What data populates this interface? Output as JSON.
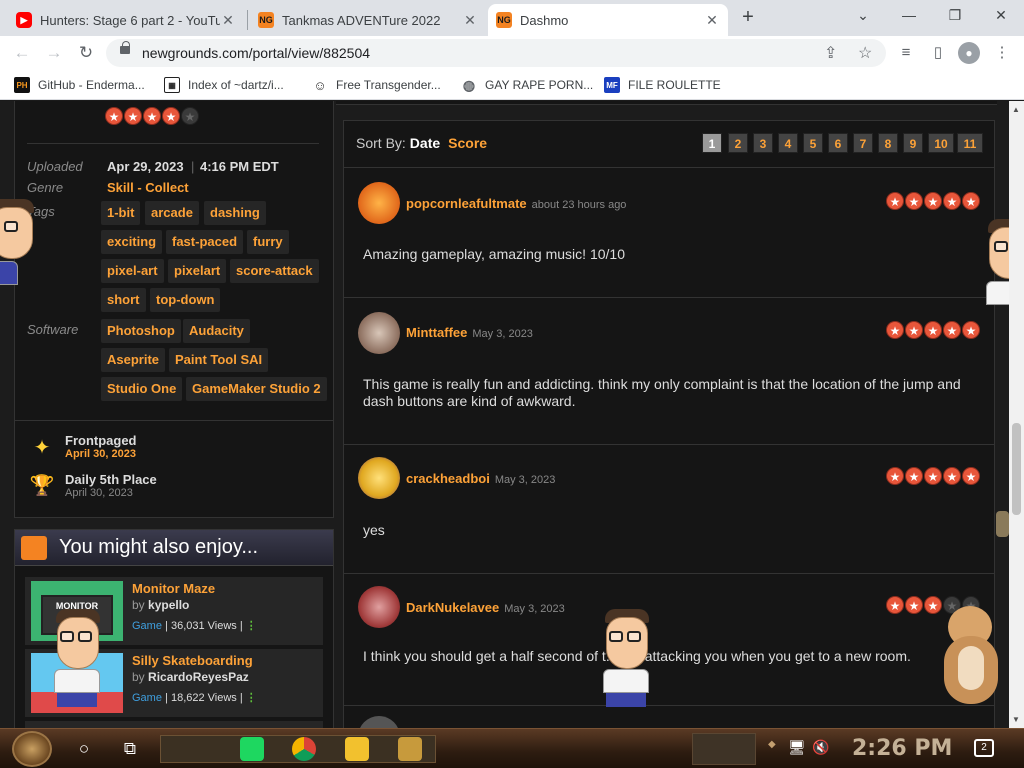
{
  "browser": {
    "tabs": [
      {
        "title": "Hunters: Stage 6 part 2 - YouTube",
        "close": "✕",
        "favicon": "youtube-icon"
      },
      {
        "title": "Tankmas ADVENTure 2022",
        "close": "✕",
        "favicon": "newgrounds-icon"
      },
      {
        "title": "Dashmo",
        "close": "✕",
        "favicon": "newgrounds-icon"
      }
    ],
    "new_tab": "+",
    "window": {
      "collapse": "⌄",
      "minimize": "—",
      "restore": "❐",
      "close": "✕"
    },
    "nav": {
      "back": "←",
      "forward": "→",
      "reload": "↻"
    },
    "url": "newgrounds.com/portal/view/882504",
    "bookmarks": [
      {
        "label": "GitHub - Enderma...",
        "icon": "PH",
        "color": "#f7971d"
      },
      {
        "label": "Index of ~dartz/i...",
        "icon": "▦",
        "color": "#222222"
      },
      {
        "label": "Free Transgender...",
        "icon": "☺",
        "color": "#555555"
      },
      {
        "label": "GAY RAPE PORN...",
        "icon": "◍",
        "color": "#5f6368"
      },
      {
        "label": "FILE ROULETTE",
        "icon": "MF",
        "color": "#1a3fbf"
      }
    ]
  },
  "info": {
    "uploaded_label": "Uploaded",
    "uploaded_date": "Apr 29, 2023",
    "uploaded_time": "4:16 PM EDT",
    "genre_label": "Genre",
    "genre": "Skill - Collect",
    "tags_label": "Tags",
    "tags": [
      "1-bit",
      "arcade",
      "dashing",
      "exciting",
      "fast-paced",
      "furry",
      "pixel-art",
      "pixelart",
      "score-attack",
      "short",
      "top-down"
    ],
    "software_label": "Software",
    "software": [
      "Photoshop",
      "Audacity",
      "Aseprite",
      "Paint Tool SAI",
      "Studio One",
      "GameMaker Studio 2"
    ],
    "rating_stars": 4
  },
  "awards": [
    {
      "title": "Frontpaged",
      "date": "April 30, 2023",
      "icon": "frontpage-icon"
    },
    {
      "title": "Daily 5th Place",
      "date": "April 30, 2023",
      "icon": "trophy-icon",
      "place": "5"
    }
  ],
  "enjoy": {
    "title": "You might also enjoy...",
    "items": [
      {
        "title": "Monitor Maze",
        "by": "by",
        "author": "kypello",
        "type": "Game",
        "views": "36,031 Views",
        "thumb_text": "MONITOR"
      },
      {
        "title": "Silly Skateboarding",
        "by": "by",
        "author": "RicardoReyesPaz",
        "type": "Game",
        "views": "18,622 Views"
      }
    ]
  },
  "reviews": {
    "sort_label": "Sort By:",
    "sort_options": [
      "Date",
      "Score"
    ],
    "pages": [
      "1",
      "2",
      "3",
      "4",
      "5",
      "6",
      "7",
      "8",
      "9",
      "10",
      "11"
    ],
    "current_page": "1",
    "items": [
      {
        "user": "popcornleafultmate",
        "time": "about 23 hours ago",
        "stars": 5,
        "text": "Amazing gameplay, amazing music! 10/10"
      },
      {
        "user": "Minttaffee",
        "time": "May 3, 2023",
        "stars": 5,
        "text": "This game is really fun and addicting. think my only complaint is that the location of the jump and dash buttons are kind of awkward."
      },
      {
        "user": "crackheadboi",
        "time": "May 3, 2023",
        "stars": 5,
        "text": "yes"
      },
      {
        "user": "DarkNukelavee",
        "time": "May 3, 2023",
        "stars": 3,
        "text": "I think you should get a half second of t... not attacking you when you get to a new room."
      }
    ]
  },
  "taskbar": {
    "clock": "2:26 PM",
    "notifications": "2",
    "apps": [
      "spotify-icon",
      "chrome-icon",
      "file-explorer-icon",
      "game-icon"
    ]
  },
  "colors": {
    "accent": "#fda238",
    "star": "#e8563a",
    "panel": "#151515"
  }
}
